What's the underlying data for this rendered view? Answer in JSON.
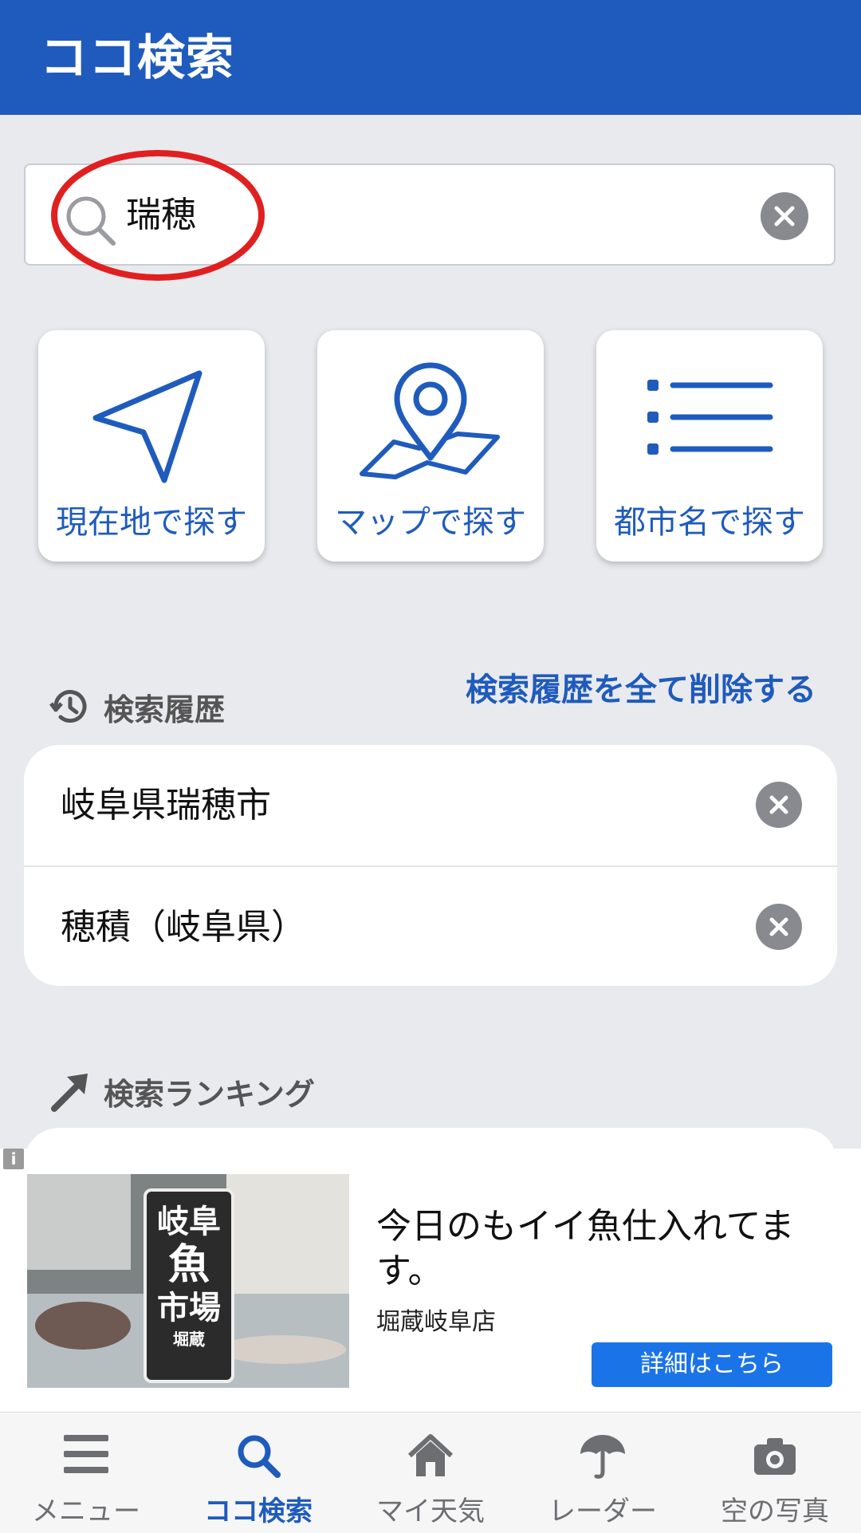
{
  "header": {
    "title": "ココ検索"
  },
  "search": {
    "value": "瑞穂",
    "icon": "search-icon",
    "clear_icon": "clear-icon"
  },
  "quick_actions": [
    {
      "label": "現在地で探す",
      "icon": "location-arrow-icon"
    },
    {
      "label": "マップで探す",
      "icon": "map-pin-icon"
    },
    {
      "label": "都市名で探す",
      "icon": "list-icon"
    }
  ],
  "history": {
    "title": "検索履歴",
    "clear_all_label": "検索履歴を全て削除する",
    "items": [
      {
        "label": "岐阜県瑞穂市"
      },
      {
        "label": "穂積（岐阜県）"
      }
    ]
  },
  "ranking": {
    "title": "検索ランキング"
  },
  "ad": {
    "info_label": "i",
    "headline": "今日のもイイ魚仕入れてます。",
    "advertiser": "堀蔵岐阜店",
    "cta_label": "詳細はこちら",
    "image_sign": {
      "line1": "岐阜",
      "line2": "魚",
      "line3": "市場",
      "line4": "堀蔵"
    }
  },
  "tabs": [
    {
      "label": "メニュー",
      "icon": "menu-icon",
      "active": false
    },
    {
      "label": "ココ検索",
      "icon": "search-icon",
      "active": true
    },
    {
      "label": "マイ天気",
      "icon": "home-icon",
      "active": false
    },
    {
      "label": "レーダー",
      "icon": "umbrella-icon",
      "active": false
    },
    {
      "label": "空の写真",
      "icon": "camera-icon",
      "active": false
    }
  ],
  "colors": {
    "brand": "#1f5bbd",
    "annotation": "#e02020",
    "cta": "#1b73e8"
  }
}
